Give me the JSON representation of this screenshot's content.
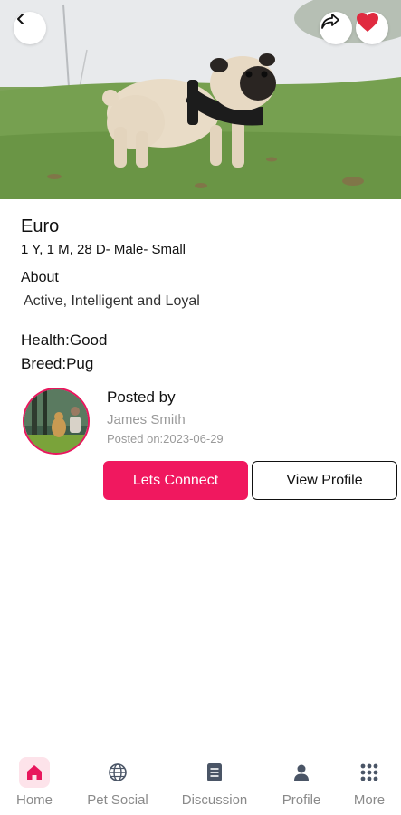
{
  "header": {
    "back_icon": "chevron-left-icon",
    "share_icon": "share-icon",
    "favorite_icon": "heart-icon",
    "favorite_color": "#e02a3f"
  },
  "pet": {
    "name": "Euro",
    "meta": "1 Y, 1 M, 28 D- Male- Small",
    "about_label": "About",
    "about_text": "Active, Intelligent and Loyal",
    "health": "Health:Good",
    "breed": "Breed:Pug"
  },
  "poster": {
    "posted_by_label": "Posted by",
    "name": "James Smith",
    "posted_on": "Posted on:2023-06-29"
  },
  "actions": {
    "connect_label": "Lets Connect",
    "view_profile_label": "View Profile",
    "accent_color": "#f0185f"
  },
  "nav": {
    "items": [
      {
        "label": "Home",
        "icon": "home-icon",
        "active": true
      },
      {
        "label": "Pet Social",
        "icon": "globe-icon",
        "active": false
      },
      {
        "label": "Discussion",
        "icon": "document-icon",
        "active": false
      },
      {
        "label": "Profile",
        "icon": "user-icon",
        "active": false
      },
      {
        "label": "More",
        "icon": "grid-icon",
        "active": false
      }
    ]
  }
}
